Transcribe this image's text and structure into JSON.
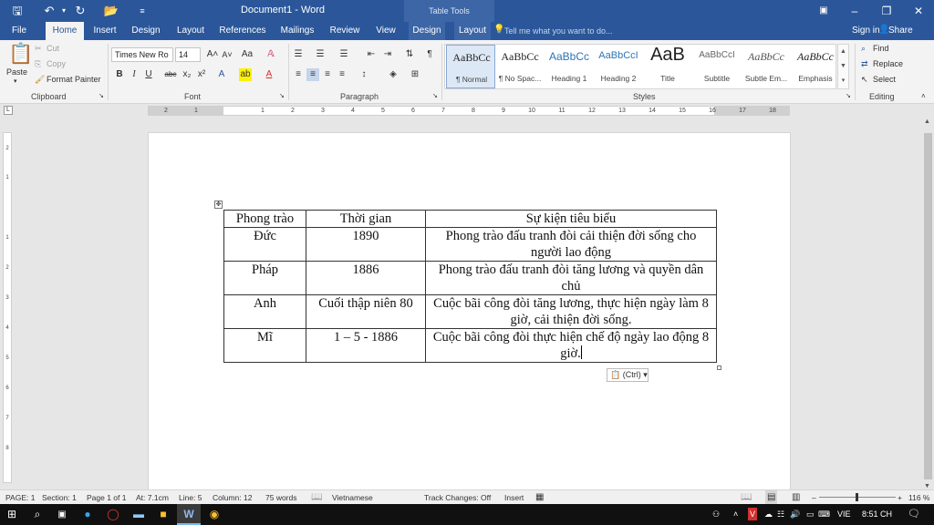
{
  "window": {
    "title": "Document1 - Word",
    "contextual_group": "Table Tools",
    "quick_access": {
      "save_icon": "save-icon",
      "undo_icon": "undo-icon",
      "redo_icon": "redo-icon",
      "open_icon": "open-icon",
      "customize_icon": "customize-icon"
    }
  },
  "tabs": [
    {
      "label": "File"
    },
    {
      "label": "Home"
    },
    {
      "label": "Insert"
    },
    {
      "label": "Design"
    },
    {
      "label": "Layout"
    },
    {
      "label": "References"
    },
    {
      "label": "Mailings"
    },
    {
      "label": "Review"
    },
    {
      "label": "View"
    },
    {
      "label": "Design"
    },
    {
      "label": "Layout"
    }
  ],
  "tellme": "Tell me what you want to do...",
  "account": {
    "signin": "Sign in",
    "share": "Share"
  },
  "ribbon": {
    "clipboard": {
      "paste": "Paste",
      "cut": "Cut",
      "copy": "Copy",
      "format_painter": "Format Painter",
      "label": "Clipboard"
    },
    "font": {
      "name": "Times New Ro",
      "size": "14",
      "label": "Font"
    },
    "paragraph": {
      "label": "Paragraph"
    },
    "styles": {
      "label": "Styles",
      "items": [
        {
          "sample": "AaBbCc",
          "name": "¶ Normal"
        },
        {
          "sample": "AaBbCc",
          "name": "¶ No Spac..."
        },
        {
          "sample": "AaBbCc",
          "name": "Heading 1"
        },
        {
          "sample": "AaBbCcI",
          "name": "Heading 2"
        },
        {
          "sample": "AaB",
          "name": "Title"
        },
        {
          "sample": "AaBbCcI",
          "name": "Subtitle"
        },
        {
          "sample": "AaBbCc",
          "name": "Subtle Em..."
        },
        {
          "sample": "AaBbCc",
          "name": "Emphasis"
        }
      ]
    },
    "editing": {
      "find": "Find",
      "replace": "Replace",
      "select": "Select",
      "label": "Editing"
    }
  },
  "table": {
    "headers": [
      "Phong trào",
      "Thời gian",
      "Sự kiện tiêu biểu"
    ],
    "rows": [
      [
        "Đức",
        "1890",
        "Phong trào đấu tranh đòi cải thiện đời sống cho người lao động"
      ],
      [
        "Pháp",
        "1886",
        "Phong trào đấu tranh đòi tăng lương và quyền dân chủ"
      ],
      [
        "Anh",
        "Cuối thập niên 80",
        "Cuộc bãi công đòi tăng lương, thực hiện ngày làm 8 giờ, cải thiện đời sống."
      ],
      [
        "Mĩ",
        "1 – 5 - 1886",
        "Cuộc bãi công đòi thực hiện chế độ ngày lao động 8 giờ."
      ]
    ],
    "paste_options": "(Ctrl)"
  },
  "status": {
    "page": "PAGE: 1",
    "section": "Section: 1",
    "page_of": "Page 1 of 1",
    "at": "At: 7.1cm",
    "line": "Line: 5",
    "column": "Column: 12",
    "words": "75 words",
    "language": "Vietnamese",
    "track_changes": "Track Changes: Off",
    "mode": "Insert",
    "zoom": "116 %"
  },
  "taskbar": {
    "ime": "VIE",
    "time": "8:51 CH"
  }
}
